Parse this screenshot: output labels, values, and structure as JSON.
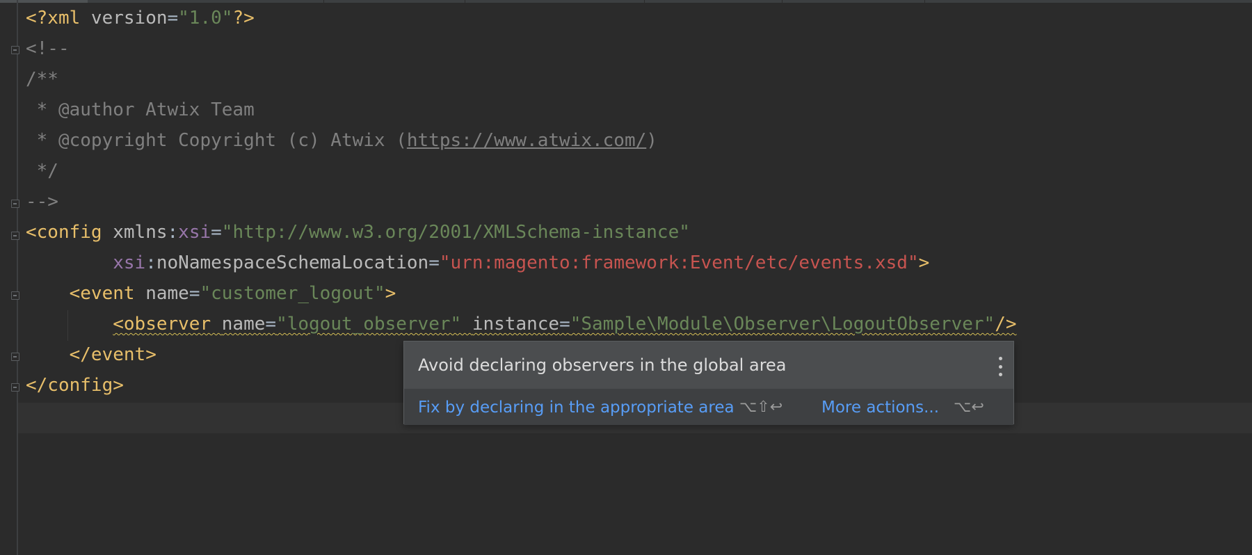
{
  "editor": {
    "lines": [
      [
        {
          "c": "tag",
          "t": "<?xml "
        },
        {
          "c": "attr",
          "t": "version"
        },
        {
          "c": "plain",
          "t": "="
        },
        {
          "c": "str",
          "t": "\"1.0\""
        },
        {
          "c": "tag",
          "t": "?>"
        }
      ],
      [
        {
          "c": "cmt",
          "t": "<!--"
        }
      ],
      [
        {
          "c": "cmt",
          "t": "/**"
        }
      ],
      [
        {
          "c": "cmt",
          "t": " * @author Atwix Team"
        }
      ],
      [
        {
          "c": "cmt",
          "t": " * @copyright Copyright (c) Atwix ("
        },
        {
          "c": "link",
          "t": "https://www.atwix.com/"
        },
        {
          "c": "cmt",
          "t": ")"
        }
      ],
      [
        {
          "c": "cmt",
          "t": " */"
        }
      ],
      [
        {
          "c": "cmt",
          "t": "-->"
        }
      ],
      [
        {
          "c": "tag",
          "t": "<config "
        },
        {
          "c": "attr",
          "t": "xmlns"
        },
        {
          "c": "plain",
          "t": ":"
        },
        {
          "c": "ns",
          "t": "xsi"
        },
        {
          "c": "plain",
          "t": "="
        },
        {
          "c": "str",
          "t": "\"http://www.w3.org/2001/XMLSchema-instance\""
        }
      ],
      [
        {
          "c": "plain",
          "t": "        "
        },
        {
          "c": "ns",
          "t": "xsi"
        },
        {
          "c": "plain",
          "t": ":"
        },
        {
          "c": "attr",
          "t": "noNamespaceSchemaLocation"
        },
        {
          "c": "plain",
          "t": "="
        },
        {
          "c": "str-red",
          "t": "\"urn:magento:framework:Event/etc/events.xsd\""
        },
        {
          "c": "tag",
          "t": ">"
        }
      ],
      [
        {
          "c": "plain",
          "t": "    "
        },
        {
          "c": "tag",
          "t": "<event "
        },
        {
          "c": "attr",
          "t": "name"
        },
        {
          "c": "plain",
          "t": "="
        },
        {
          "c": "str",
          "t": "\"customer_logout\""
        },
        {
          "c": "tag",
          "t": ">"
        }
      ],
      [
        {
          "c": "plain",
          "t": "        "
        },
        {
          "c": "tag squiggle",
          "t": "<observer "
        },
        {
          "c": "attr squiggle",
          "t": "name"
        },
        {
          "c": "plain squiggle",
          "t": "="
        },
        {
          "c": "str squiggle",
          "t": "\"logout_observer\" "
        },
        {
          "c": "attr squiggle",
          "t": "instance"
        },
        {
          "c": "plain squiggle",
          "t": "="
        },
        {
          "c": "str squiggle",
          "t": "\"Sample\\Module\\Observer\\LogoutObserver\""
        },
        {
          "c": "tag squiggle",
          "t": "/>"
        }
      ],
      [
        {
          "c": "plain",
          "t": "    "
        },
        {
          "c": "tag",
          "t": "</event>"
        }
      ],
      [
        {
          "c": "tag",
          "t": "</config>"
        }
      ],
      []
    ]
  },
  "popup": {
    "title": "Avoid declaring observers in the global area",
    "primary_action": "Fix by declaring in the appropriate area",
    "primary_shortcut": "⌥⇧↩",
    "more_actions": "More actions...",
    "more_shortcut": "⌥↩",
    "menu_icon": "kebab-menu-icon"
  },
  "colors": {
    "background": "#2b2b2b",
    "tag": "#e8bf6a",
    "string": "#6a8759",
    "namespace": "#9876aa",
    "comment": "#808080",
    "link_action": "#589df6",
    "warning_underline": "#d6bf55"
  }
}
